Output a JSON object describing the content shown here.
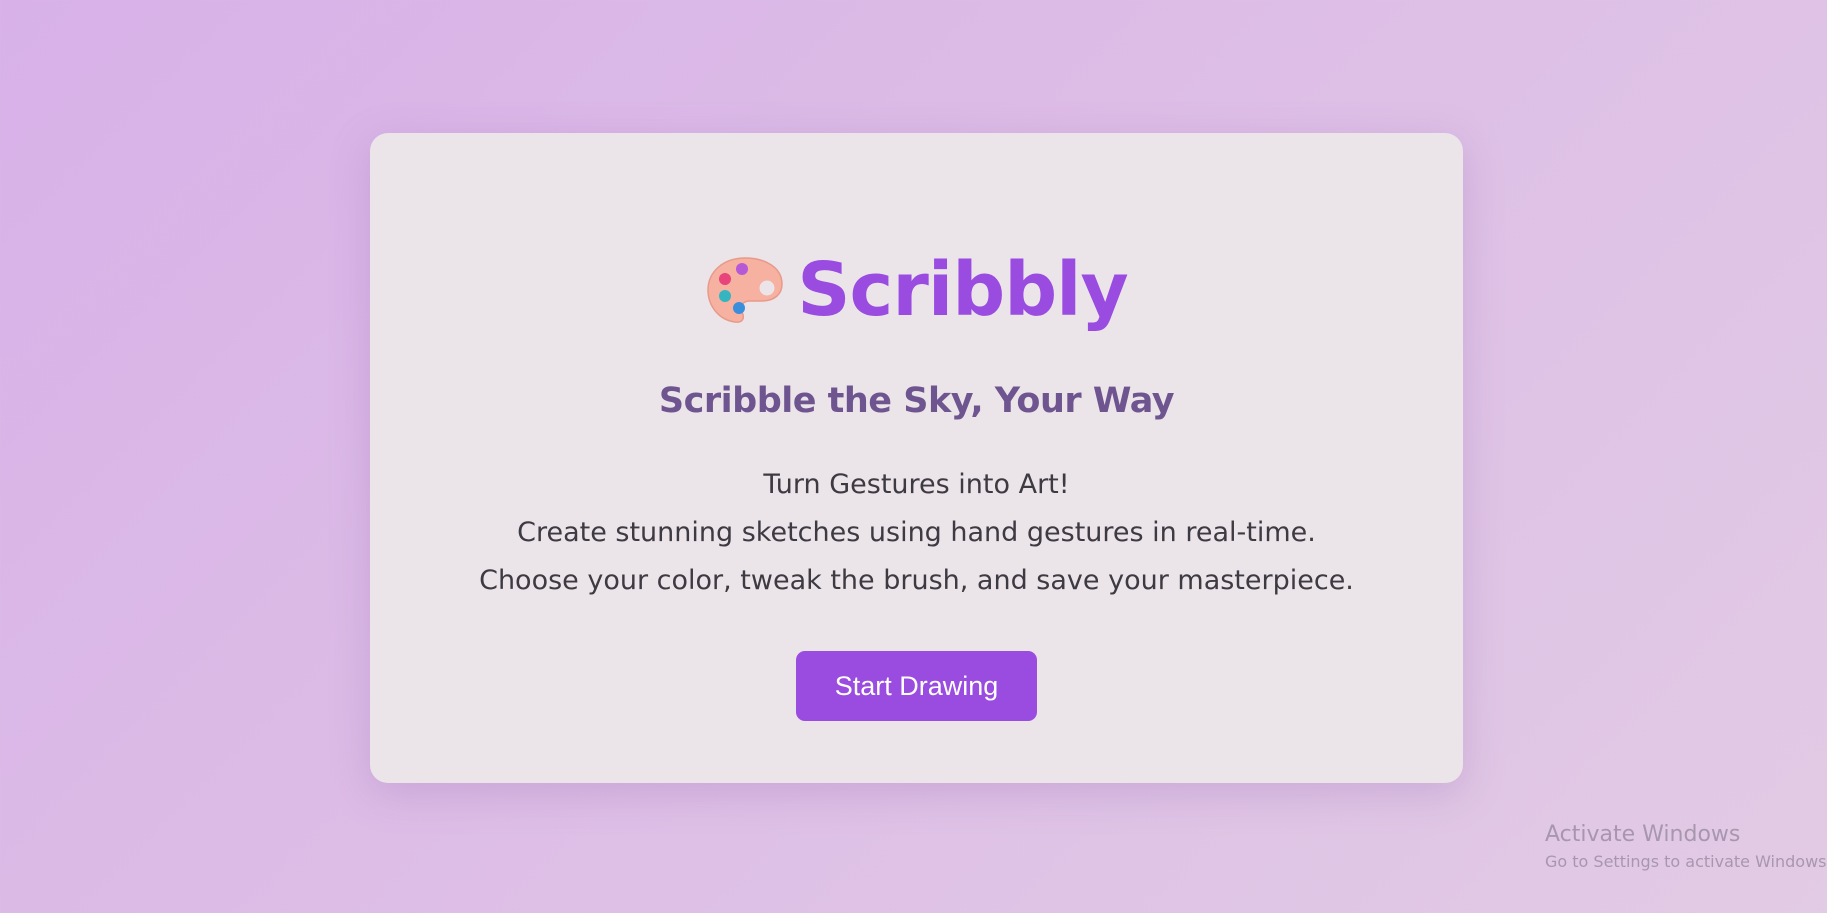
{
  "app": {
    "icon": "artist-palette-icon",
    "title": "Scribbly",
    "tagline": "Scribble the Sky, Your Way",
    "description": [
      "Turn Gestures into Art!",
      "Create stunning sketches using hand gestures in real-time.",
      "Choose your color, tweak the brush, and save your masterpiece."
    ],
    "cta_label": "Start Drawing"
  },
  "watermark": {
    "title": "Activate Windows",
    "subtitle": "Go to Settings to activate Windows."
  },
  "colors": {
    "accent": "#9a4be0",
    "tagline": "#6f5590",
    "card_bg": "#ebe5ea",
    "page_bg_start": "#d7b1e8",
    "page_bg_end": "#e2cbe5"
  }
}
